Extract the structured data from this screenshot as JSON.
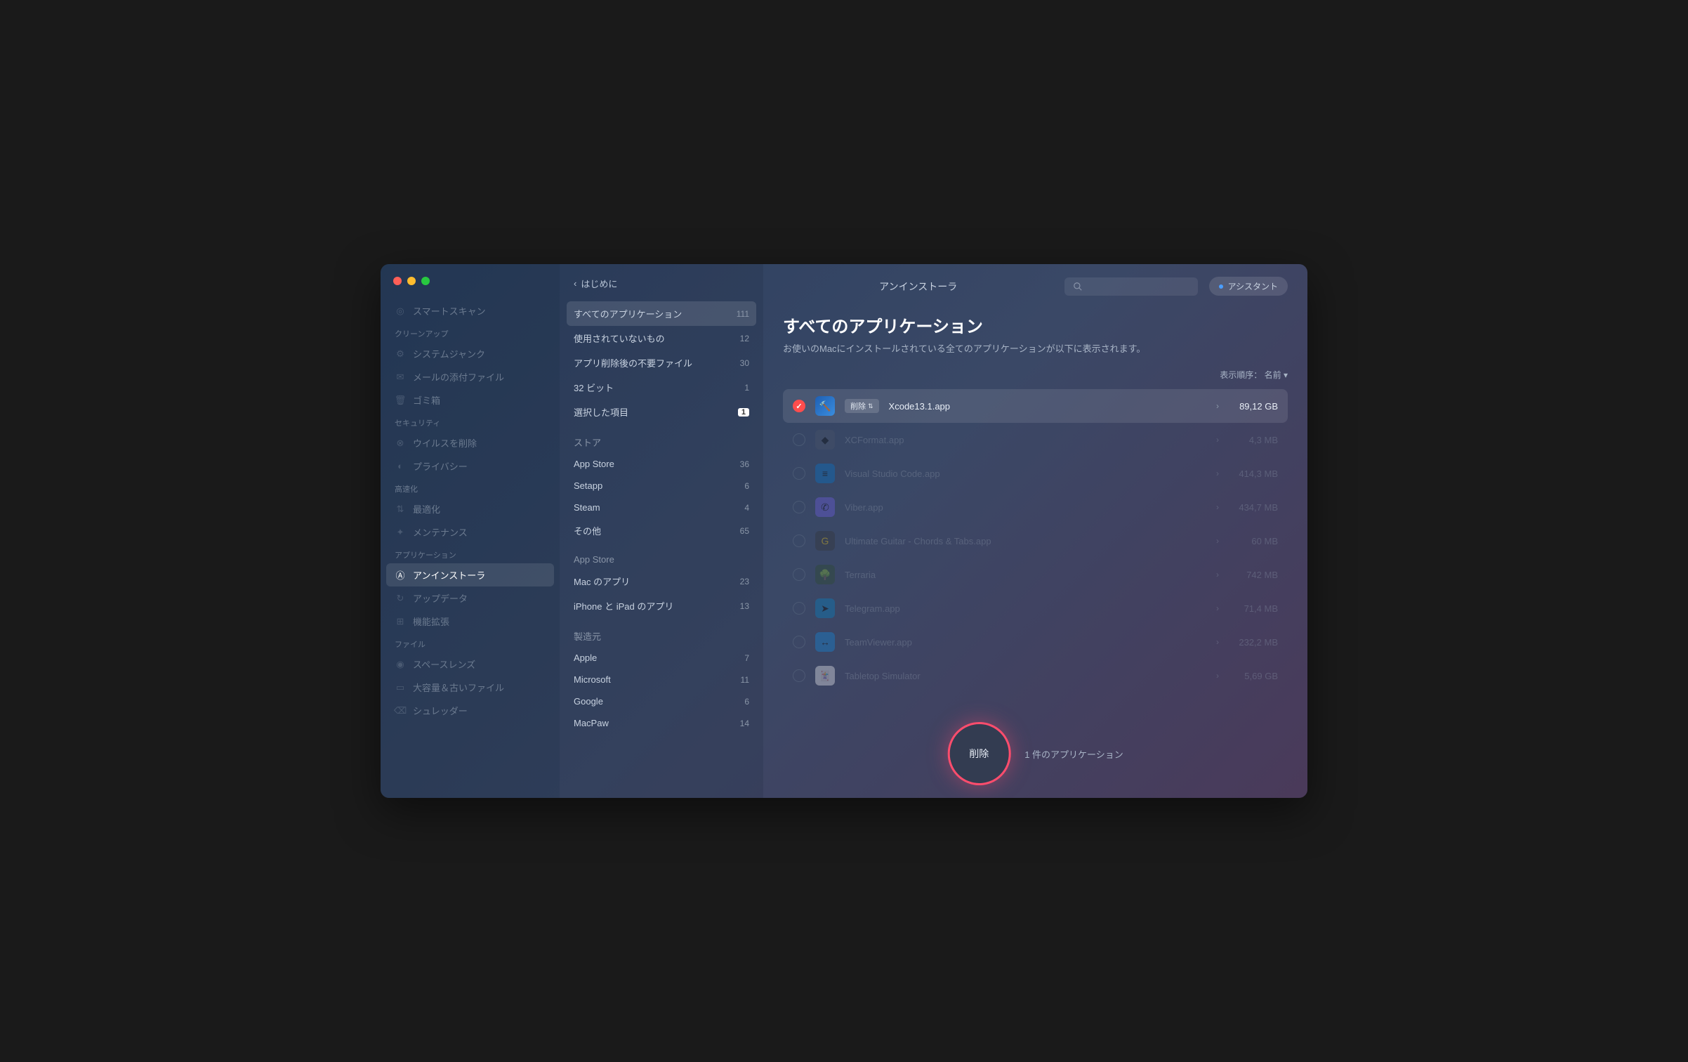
{
  "header": {
    "back": "はじめに",
    "title": "アンインストーラ",
    "assistant": "アシスタント"
  },
  "sidebar": {
    "items": [
      {
        "type": "item",
        "label": "スマートスキャン",
        "icon": "◎"
      },
      {
        "type": "section",
        "label": "クリーンアップ"
      },
      {
        "type": "item",
        "label": "システムジャンク",
        "icon": "⚙"
      },
      {
        "type": "item",
        "label": "メールの添付ファイル",
        "icon": "✉"
      },
      {
        "type": "item",
        "label": "ゴミ箱",
        "icon": "🗑"
      },
      {
        "type": "section",
        "label": "セキュリティ"
      },
      {
        "type": "item",
        "label": "ウイルスを削除",
        "icon": "⊗"
      },
      {
        "type": "item",
        "label": "プライバシー",
        "icon": "◐"
      },
      {
        "type": "section",
        "label": "高速化"
      },
      {
        "type": "item",
        "label": "最適化",
        "icon": "⇅"
      },
      {
        "type": "item",
        "label": "メンテナンス",
        "icon": "✦"
      },
      {
        "type": "section",
        "label": "アプリケーション"
      },
      {
        "type": "item",
        "label": "アンインストーラ",
        "icon": "Ⓐ",
        "active": true
      },
      {
        "type": "item",
        "label": "アップデータ",
        "icon": "↻"
      },
      {
        "type": "item",
        "label": "機能拡張",
        "icon": "⊞"
      },
      {
        "type": "section",
        "label": "ファイル"
      },
      {
        "type": "item",
        "label": "スペースレンズ",
        "icon": "◉"
      },
      {
        "type": "item",
        "label": "大容量＆古いファイル",
        "icon": "▭"
      },
      {
        "type": "item",
        "label": "シュレッダー",
        "icon": "⌫"
      }
    ]
  },
  "filters": {
    "groups": [
      {
        "header": null,
        "items": [
          {
            "label": "すべてのアプリケーション",
            "count": "111",
            "active": true
          },
          {
            "label": "使用されていないもの",
            "count": "12"
          },
          {
            "label": "アプリ削除後の不要ファイル",
            "count": "30"
          },
          {
            "label": "32 ビット",
            "count": "1"
          },
          {
            "label": "選択した項目",
            "count": "1",
            "badge": true
          }
        ]
      },
      {
        "header": "ストア",
        "items": [
          {
            "label": "App Store",
            "count": "36"
          },
          {
            "label": "Setapp",
            "count": "6"
          },
          {
            "label": "Steam",
            "count": "4"
          },
          {
            "label": "その他",
            "count": "65"
          }
        ]
      },
      {
        "header": "App Store",
        "items": [
          {
            "label": "Mac のアプリ",
            "count": "23"
          },
          {
            "label": "iPhone と iPad のアプリ",
            "count": "13"
          }
        ]
      },
      {
        "header": "製造元",
        "items": [
          {
            "label": "Apple",
            "count": "7"
          },
          {
            "label": "Microsoft",
            "count": "11"
          },
          {
            "label": "Google",
            "count": "6"
          },
          {
            "label": "MacPaw",
            "count": "14"
          }
        ]
      }
    ]
  },
  "main": {
    "title": "すべてのアプリケーション",
    "subtitle": "お使いのMacにインストールされている全てのアプリケーションが以下に表示されます。",
    "sort_label": "表示順序：",
    "sort_value": "名前",
    "action_tag": "削除",
    "apps": [
      {
        "name": "Xcode13.1.app",
        "size": "89,12 GB",
        "selected": true,
        "iconClass": "xcode",
        "icon": "🔨"
      },
      {
        "name": "XCFormat.app",
        "size": "4,3 MB",
        "iconClass": "",
        "icon": "◆"
      },
      {
        "name": "Visual Studio Code.app",
        "size": "414,3 MB",
        "iconClass": "vscode",
        "icon": "≡"
      },
      {
        "name": "Viber.app",
        "size": "434,7 MB",
        "iconClass": "viber",
        "icon": "✆"
      },
      {
        "name": "Ultimate Guitar - Chords & Tabs.app",
        "size": "60 MB",
        "iconClass": "ug",
        "icon": "G"
      },
      {
        "name": "Terraria",
        "size": "742 MB",
        "iconClass": "terraria",
        "icon": "🌳"
      },
      {
        "name": "Telegram.app",
        "size": "71,4 MB",
        "iconClass": "telegram",
        "icon": "➤"
      },
      {
        "name": "TeamViewer.app",
        "size": "232,2 MB",
        "iconClass": "teamviewer",
        "icon": "↔"
      },
      {
        "name": "Tabletop Simulator",
        "size": "5,69 GB",
        "iconClass": "tabletop",
        "icon": "🃏"
      }
    ]
  },
  "action": {
    "button": "削除",
    "summary": "1 件のアプリケーション"
  }
}
